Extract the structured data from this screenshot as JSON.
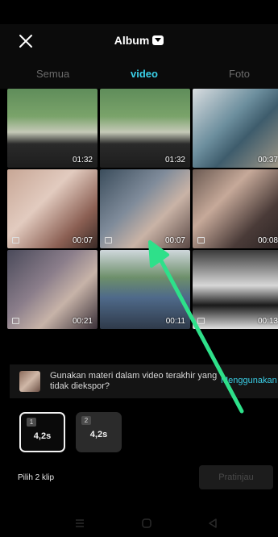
{
  "header": {
    "title": "Album",
    "close_icon": "close-icon",
    "caret_icon": "chevron-down-icon"
  },
  "tabs": [
    {
      "label": "Semua",
      "active": false
    },
    {
      "label": "video",
      "active": true
    },
    {
      "label": "Foto",
      "active": false
    }
  ],
  "accent_color": "#3ad0e8",
  "media": [
    {
      "duration": "01:32"
    },
    {
      "duration": "01:32"
    },
    {
      "duration": "00:37"
    },
    {
      "duration": "00:07"
    },
    {
      "duration": "00:07"
    },
    {
      "duration": "00:08"
    },
    {
      "duration": "00:21"
    },
    {
      "duration": "00:11"
    },
    {
      "duration": "00:13"
    }
  ],
  "banner": {
    "text": "Gunakan materi dalam video terakhir yang tidak diekspor?",
    "action": "Menggunakan"
  },
  "clips": [
    {
      "index": "1",
      "duration": "4,2s",
      "selected": true
    },
    {
      "index": "2",
      "duration": "4,2s",
      "selected": false
    }
  ],
  "footer": {
    "selection_label": "Pilih 2 klip",
    "preview_label": "Pratinjau"
  },
  "annotation": {
    "type": "green arrow pointing to second video in second row",
    "color": "#2ee08a"
  }
}
